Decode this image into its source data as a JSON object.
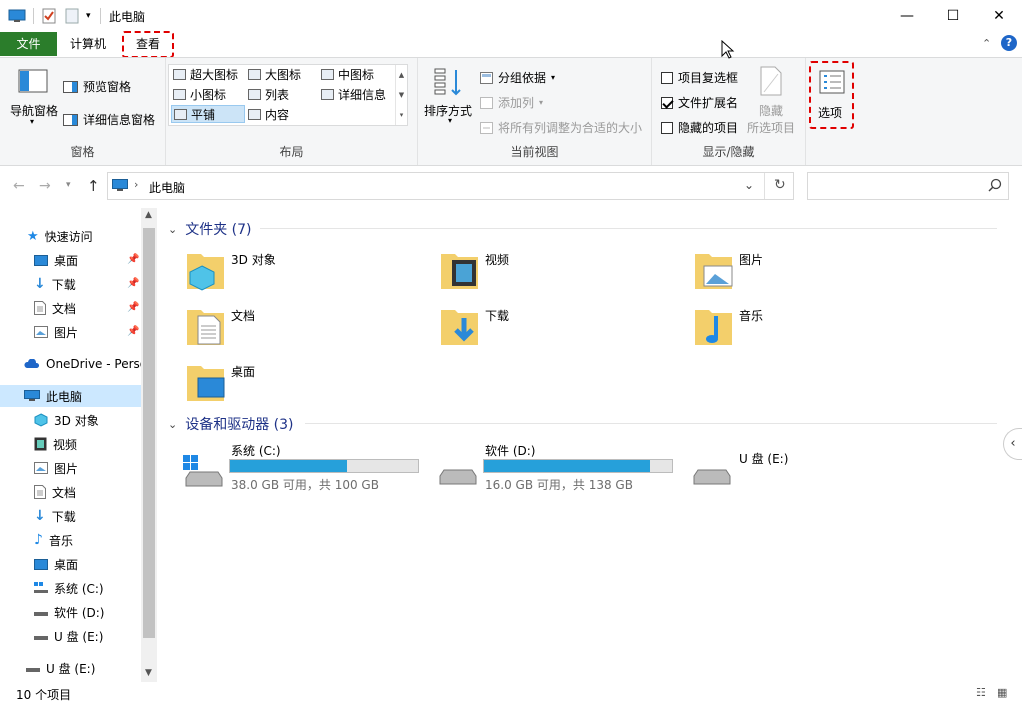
{
  "window": {
    "title": "此电脑",
    "minimize": "—",
    "maximize": "☐",
    "close": "✕"
  },
  "ribbon_tabs": {
    "file": "文件",
    "computer": "计算机",
    "view": "查看"
  },
  "ribbon": {
    "panes": {
      "nav_pane": "导航窗格",
      "preview_pane": "预览窗格",
      "details_pane": "详细信息窗格",
      "label": "窗格"
    },
    "layout": {
      "items": [
        "超大图标",
        "大图标",
        "中图标",
        "小图标",
        "列表",
        "详细信息",
        "平铺",
        "内容"
      ],
      "label": "布局"
    },
    "current_view": {
      "sort_by": "排序方式",
      "group_by": "分组依据",
      "add_columns": "添加列",
      "fit_columns": "将所有列调整为合适的大小",
      "label": "当前视图"
    },
    "show_hide": {
      "item_checkboxes": "项目复选框",
      "item_checkboxes_checked": false,
      "file_extensions": "文件扩展名",
      "file_extensions_checked": true,
      "hidden_items": "隐藏的项目",
      "hidden_items_checked": false,
      "hide": "隐藏",
      "selected_items": "所选项目",
      "label": "显示/隐藏"
    },
    "options": "选项"
  },
  "address": {
    "location": "此电脑",
    "search_placeholder": ""
  },
  "nav_pane": {
    "quick_access": "快速访问",
    "qa_items": [
      "桌面",
      "下载",
      "文档",
      "图片"
    ],
    "onedrive": "OneDrive - Perso",
    "this_pc": "此电脑",
    "pc_items": [
      "3D 对象",
      "视频",
      "图片",
      "文档",
      "下载",
      "音乐",
      "桌面",
      "系统 (C:)",
      "软件 (D:)",
      "U 盘 (E:)"
    ],
    "usb": "U 盘 (E:)"
  },
  "content": {
    "folders_header": "文件夹 (7)",
    "folders": [
      "3D 对象",
      "视频",
      "图片",
      "文档",
      "下载",
      "音乐",
      "桌面"
    ],
    "devices_header": "设备和驱动器 (3)",
    "drives": [
      {
        "name": "系统 (C:)",
        "space": "38.0 GB 可用，共 100 GB",
        "used_fraction": 0.62
      },
      {
        "name": "软件 (D:)",
        "space": "16.0 GB 可用，共 138 GB",
        "used_fraction": 0.884
      },
      {
        "name": "U 盘 (E:)",
        "space": ""
      }
    ]
  },
  "status": {
    "count": "10 个项目"
  },
  "colors": {
    "file_tab": "#2b7d2b",
    "accent": "#1e3287",
    "drive_bar": "#26a0da",
    "highlight": "#e00000"
  }
}
